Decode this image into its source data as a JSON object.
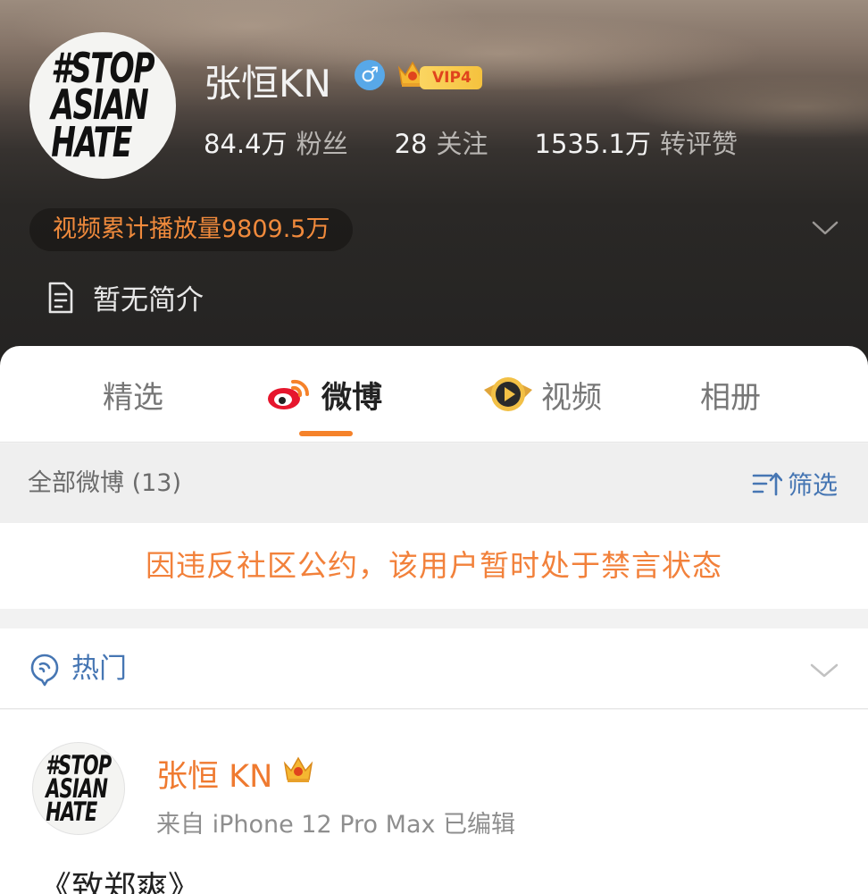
{
  "profile": {
    "avatar_logo": [
      "#STOP",
      "ASIAN",
      "HATE"
    ],
    "username": "张恒KN",
    "gender_symbol": "♂",
    "vip_label": "VIP4",
    "stats": [
      {
        "value": "84.4万",
        "label": "粉丝"
      },
      {
        "value": "28",
        "label": "关注"
      },
      {
        "value": "1535.1万",
        "label": "转评赞"
      }
    ],
    "video_plays": "视频累计播放量9809.5万",
    "bio": "暂无简介"
  },
  "tabs": [
    {
      "label": "精选",
      "active": false
    },
    {
      "label": "微博",
      "active": true,
      "icon": "weibo-icon"
    },
    {
      "label": "视频",
      "active": false,
      "icon": "video-play-icon"
    },
    {
      "label": "相册",
      "active": false
    }
  ],
  "filter_bar": {
    "count_label": "全部微博 (13)",
    "filter_label": "筛选"
  },
  "ban_notice": "因违反社区公约，该用户暂时处于禁言状态",
  "hot": {
    "label": "热门"
  },
  "post": {
    "author": "张恒 KN",
    "meta": "来自 iPhone 12 Pro Max  已编辑",
    "text": "《致郑爽》"
  },
  "colors": {
    "accent_orange": "#f5822a",
    "link_blue": "#4676b3",
    "gender_blue": "#58a8e8",
    "vip_gold": "#f5c23e"
  }
}
